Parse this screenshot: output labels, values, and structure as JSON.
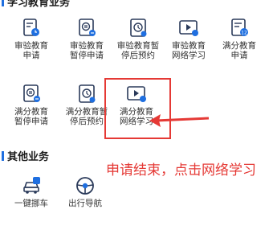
{
  "sections": {
    "study": {
      "title": "学习教育业务"
    },
    "other": {
      "title": "其他业务"
    }
  },
  "study_items": [
    {
      "label": "审验教育\n申请",
      "icon": "document-clock-icon"
    },
    {
      "label": "审验教育\n暂停申请",
      "icon": "document-pause-icon"
    },
    {
      "label": "审验教育暂\n停后预约",
      "icon": "document-calendar-icon"
    },
    {
      "label": "审验教育\n网络学习",
      "icon": "video-play-icon"
    },
    {
      "label": "满分教育\n申请",
      "icon": "document-12-icon"
    },
    {
      "label": "满分教育\n暂停申请",
      "icon": "document-pause-icon"
    },
    {
      "label": "满分教育暂\n停后预约",
      "icon": "document-calendar-icon"
    },
    {
      "label": "满分教育\n网络学习",
      "icon": "video-play-icon"
    }
  ],
  "other_items": [
    {
      "label": "一键挪车",
      "icon": "car-move-icon"
    },
    {
      "label": "出行导航",
      "icon": "steering-wheel-icon"
    }
  ],
  "annotation": {
    "text": "申请结束，点击网络学习",
    "color": "#e53935"
  },
  "colors": {
    "accent": "#1f6fe0",
    "icon_stroke": "#2a3a5a",
    "badge_blue": "#1f6fe0",
    "highlight": "#e53935"
  }
}
